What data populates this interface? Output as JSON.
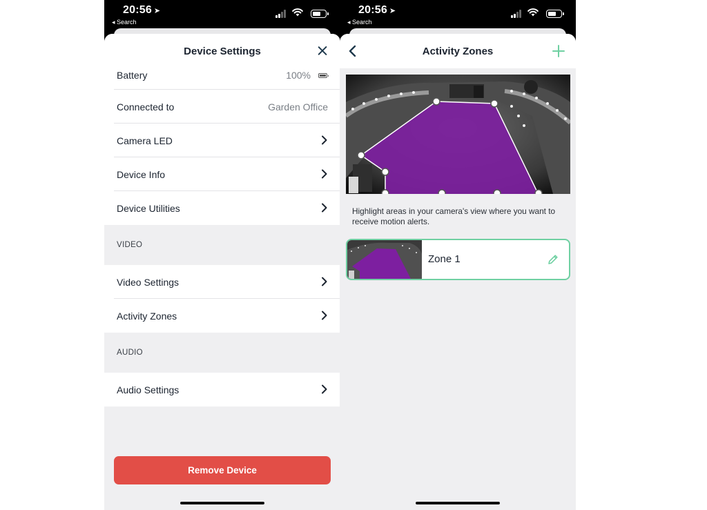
{
  "status_bar": {
    "time": "20:56",
    "location_arrow": "location-arrow-icon",
    "back_label": "◂ Search"
  },
  "device_settings": {
    "title": "Device Settings",
    "close_icon": "close-icon",
    "rows_general": [
      {
        "label": "Battery",
        "value": "100%",
        "icon": "battery-icon"
      },
      {
        "label": "Connected to",
        "value": "Garden Office"
      },
      {
        "label": "Camera LED",
        "icon": "chevron-right-icon"
      },
      {
        "label": "Device Info",
        "icon": "chevron-right-icon"
      },
      {
        "label": "Device Utilities",
        "icon": "chevron-right-icon"
      }
    ],
    "section_video": "VIDEO",
    "rows_video": [
      {
        "label": "Video Settings",
        "icon": "chevron-right-icon"
      },
      {
        "label": "Activity Zones",
        "icon": "chevron-right-icon"
      }
    ],
    "section_audio": "AUDIO",
    "rows_audio": [
      {
        "label": "Audio Settings",
        "icon": "chevron-right-icon"
      }
    ],
    "remove_button": "Remove Device"
  },
  "activity_zones": {
    "title": "Activity Zones",
    "back_icon": "chevron-left-icon",
    "add_icon": "plus-icon",
    "hint": "Highlight areas in your camera's view where you want to receive motion alerts.",
    "zones": [
      {
        "name": "Zone 1",
        "edit_icon": "pencil-icon"
      }
    ]
  },
  "colors": {
    "accent_green": "#6fd0a2",
    "zone_purple": "#7d1fa0",
    "remove_red": "#e24e47",
    "nav_dark": "#1f3a4d"
  }
}
